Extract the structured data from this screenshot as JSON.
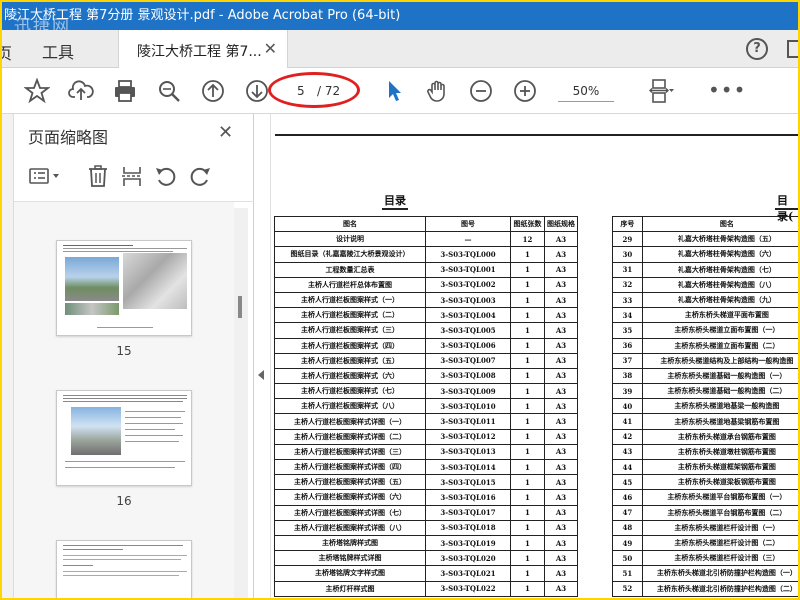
{
  "window": {
    "title": "陵江大桥工程 第7分册 景观设计.pdf - Adobe Acrobat Pro (64-bit)",
    "watermark": "迅捷网"
  },
  "tabs": {
    "home": "页",
    "tools": "工具",
    "doc_title": "陵江大桥工程 第7...",
    "close": "✕",
    "help": "?"
  },
  "toolbar": {
    "current_page": "5",
    "total_pages": "/ 72",
    "zoom": "50%"
  },
  "left_panel": {
    "title": "页面缩略图",
    "close": "✕",
    "thumbnails": [
      {
        "page": "15"
      },
      {
        "page": "16"
      }
    ]
  },
  "document": {
    "heading_left": "目录",
    "heading_right": "目录(",
    "left_table": {
      "headers": [
        "图名",
        "图号",
        "图纸张数",
        "图纸规格"
      ],
      "rows": [
        [
          "设计说明",
          "—",
          "12",
          "A3"
        ],
        [
          "图纸目录（礼嘉嘉陵江大桥景观设计）",
          "3-S03-TQL000",
          "1",
          "A3"
        ],
        [
          "工程数量汇总表",
          "3-S03-TQL001",
          "1",
          "A3"
        ],
        [
          "主桥人行道栏杆总体布置图",
          "3-S03-TQL002",
          "1",
          "A3"
        ],
        [
          "主桥人行道栏板图案样式（一）",
          "3-S03-TQL003",
          "1",
          "A3"
        ],
        [
          "主桥人行道栏板图案样式（二）",
          "3-S03-TQL004",
          "1",
          "A3"
        ],
        [
          "主桥人行道栏板图案样式（三）",
          "3-S03-TQL005",
          "1",
          "A3"
        ],
        [
          "主桥人行道栏板图案样式（四）",
          "3-S03-TQL006",
          "1",
          "A3"
        ],
        [
          "主桥人行道栏板图案样式（五）",
          "3-S03-TQL007",
          "1",
          "A3"
        ],
        [
          "主桥人行道栏板图案样式（六）",
          "3-S03-TQL008",
          "1",
          "A3"
        ],
        [
          "主桥人行道栏板图案样式（七）",
          "3-S03-TQL009",
          "1",
          "A3"
        ],
        [
          "主桥人行道栏板图案样式（八）",
          "3-S03-TQL010",
          "1",
          "A3"
        ],
        [
          "主桥人行道栏板图案样式详图（一）",
          "3-S03-TQL011",
          "1",
          "A3"
        ],
        [
          "主桥人行道栏板图案样式详图（二）",
          "3-S03-TQL012",
          "1",
          "A3"
        ],
        [
          "主桥人行道栏板图案样式详图（三）",
          "3-S03-TQL013",
          "1",
          "A3"
        ],
        [
          "主桥人行道栏板图案样式详图（四）",
          "3-S03-TQL014",
          "1",
          "A3"
        ],
        [
          "主桥人行道栏板图案样式详图（五）",
          "3-S03-TQL015",
          "1",
          "A3"
        ],
        [
          "主桥人行道栏板图案样式详图（六）",
          "3-S03-TQL016",
          "1",
          "A3"
        ],
        [
          "主桥人行道栏板图案样式详图（七）",
          "3-S03-TQL017",
          "1",
          "A3"
        ],
        [
          "主桥人行道栏板图案样式详图（八）",
          "3-S03-TQL018",
          "1",
          "A3"
        ],
        [
          "主桥塔铭牌样式图",
          "3-S03-TQL019",
          "1",
          "A3"
        ],
        [
          "主桥塔铭牌样式详图",
          "3-S03-TQL020",
          "1",
          "A3"
        ],
        [
          "主桥塔铭牌文字样式图",
          "3-S03-TQL021",
          "1",
          "A3"
        ],
        [
          "主桥灯杆样式图",
          "3-S03-TQL022",
          "1",
          "A3"
        ]
      ]
    },
    "right_table": {
      "headers": [
        "序号",
        "图名"
      ],
      "rows": [
        [
          "29",
          "礼嘉大桥塔柱骨架构造图（五）"
        ],
        [
          "30",
          "礼嘉大桥塔柱骨架构造图（六）"
        ],
        [
          "31",
          "礼嘉大桥塔柱骨架构造图（七）"
        ],
        [
          "32",
          "礼嘉大桥塔柱骨架构造图（八）"
        ],
        [
          "33",
          "礼嘉大桥塔柱骨架构造图（九）"
        ],
        [
          "34",
          "主桥东桥头梯道平面布置图"
        ],
        [
          "35",
          "主桥东桥头梯道立面布置图（一）"
        ],
        [
          "36",
          "主桥东桥头梯道立面布置图（二）"
        ],
        [
          "37",
          "主桥东桥头梯道结构及上部结构一般构造图"
        ],
        [
          "38",
          "主桥东桥头梯道基础一般构造图（一）"
        ],
        [
          "39",
          "主桥东桥头梯道基础一般构造图（二）"
        ],
        [
          "40",
          "主桥东桥头梯道地基梁一般构造图"
        ],
        [
          "41",
          "主桥东桥头梯道地基梁钢筋布置图"
        ],
        [
          "42",
          "主桥东桥头梯道承台钢筋布置图"
        ],
        [
          "43",
          "主桥东桥头梯道墩柱钢筋布置图"
        ],
        [
          "44",
          "主桥东桥头梯道框架钢筋布置图"
        ],
        [
          "45",
          "主桥东桥头梯道梁板钢筋布置图"
        ],
        [
          "46",
          "主桥东桥头梯道平台钢筋布置图（一）"
        ],
        [
          "47",
          "主桥东桥头梯道平台钢筋布置图（二）"
        ],
        [
          "48",
          "主桥东桥头梯道栏杆设计图（一）"
        ],
        [
          "49",
          "主桥东桥头梯道栏杆设计图（二）"
        ],
        [
          "50",
          "主桥东桥头梯道栏杆设计图（三）"
        ],
        [
          "51",
          "主桥东桥头梯道北引桥防撞护栏构造图（一）"
        ],
        [
          "52",
          "主桥东桥头梯道北引桥防撞护栏构造图（二）"
        ]
      ]
    }
  }
}
